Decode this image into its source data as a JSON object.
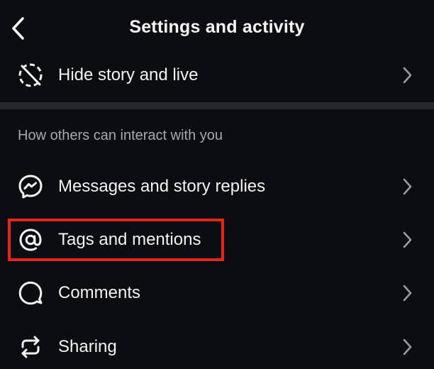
{
  "header": {
    "back_icon": "chevron-left-icon",
    "title": "Settings and activity"
  },
  "rows_top": [
    {
      "label": "Hide story and live",
      "icon": "hide-story-icon"
    }
  ],
  "section": {
    "heading": "How others can interact with you",
    "items": [
      {
        "label": "Messages and story replies",
        "icon": "messenger-icon"
      },
      {
        "label": "Tags and mentions",
        "icon": "at-sign-icon",
        "highlighted": true
      },
      {
        "label": "Comments",
        "icon": "comment-bubble-icon"
      },
      {
        "label": "Sharing",
        "icon": "share-arrows-icon"
      }
    ]
  },
  "colors": {
    "background": "#0c0d10",
    "divider": "#25272b",
    "highlight": "#e8251b",
    "text": "#f2f2f2",
    "muted": "#a8a9ad"
  }
}
